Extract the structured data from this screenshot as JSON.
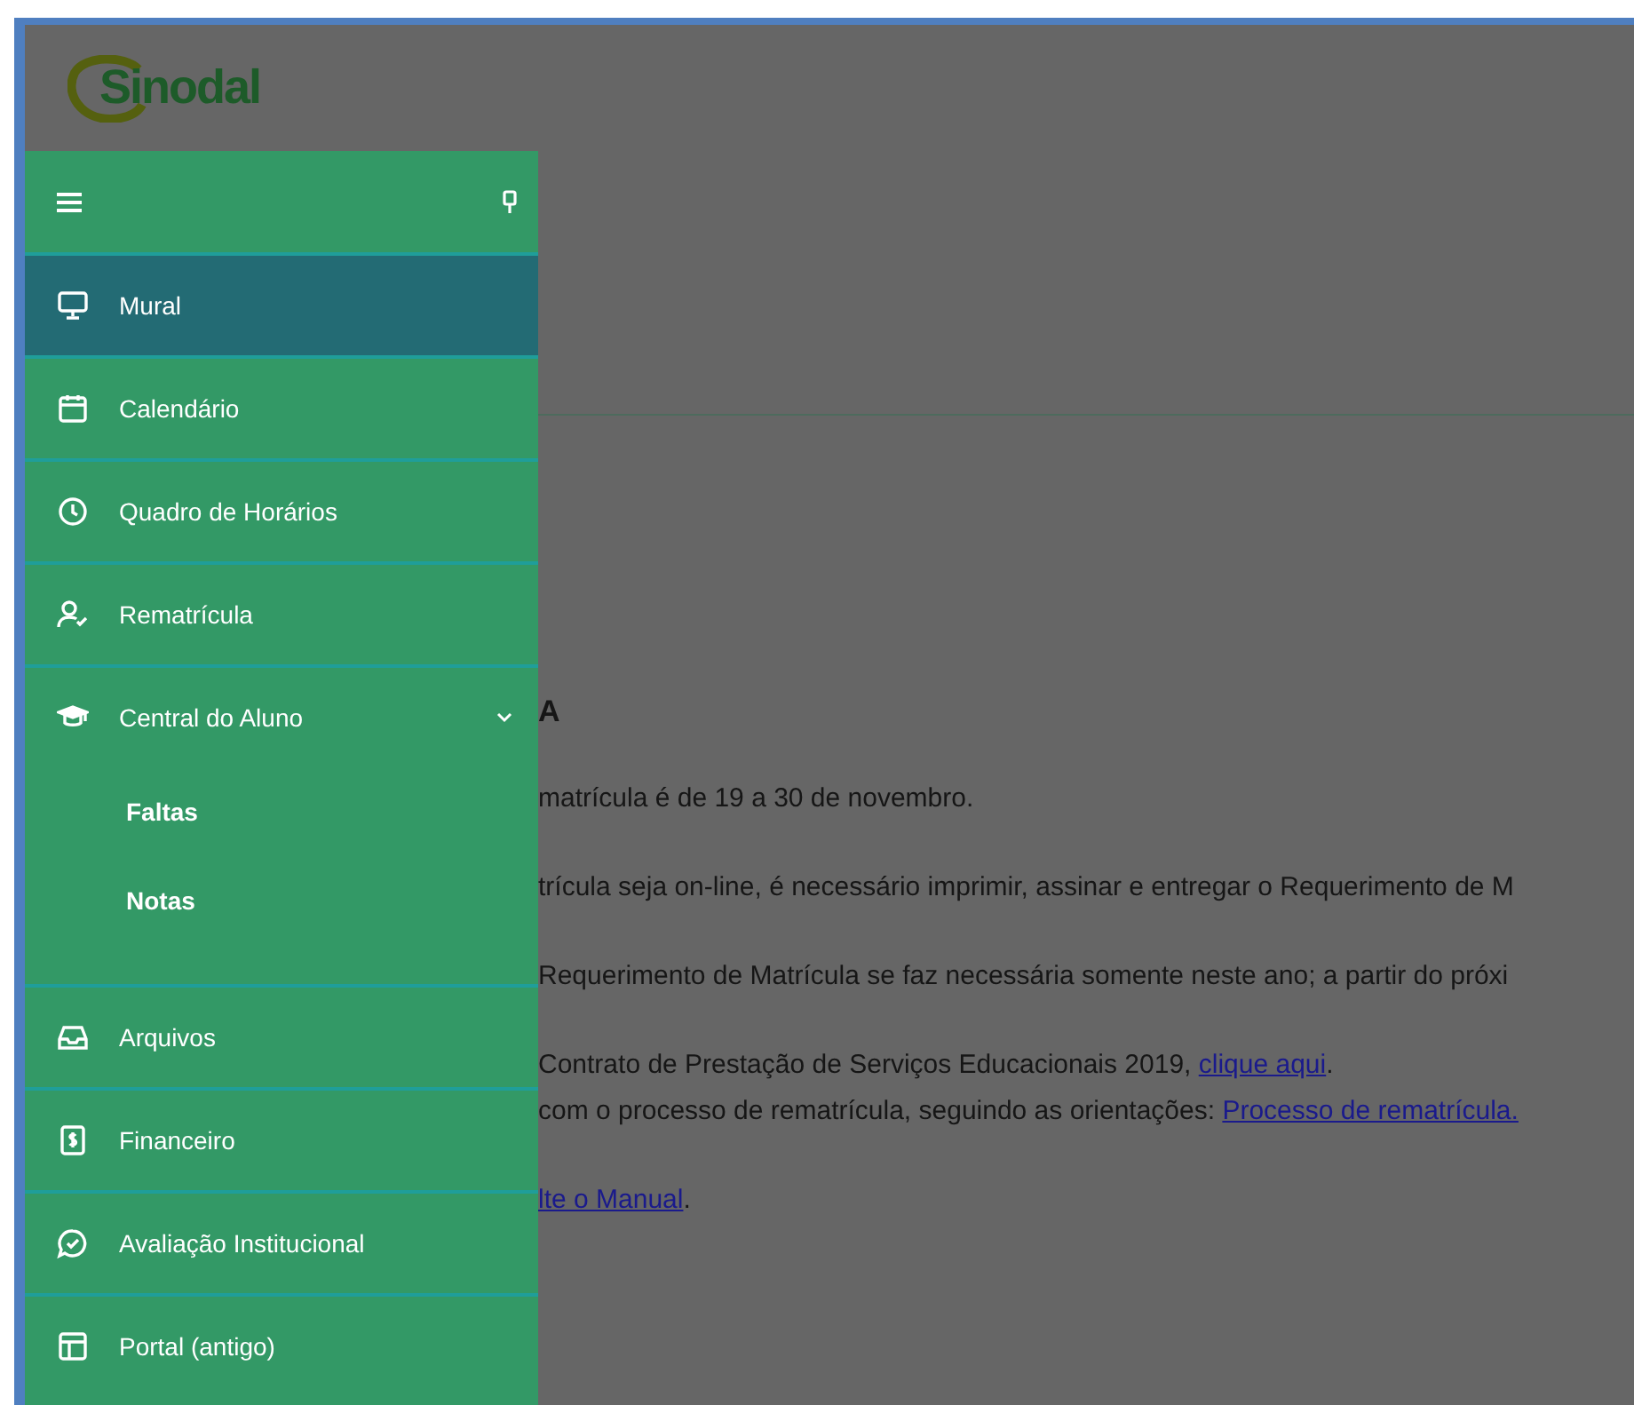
{
  "header": {
    "logo_text": "Sinodal"
  },
  "sidebar": {
    "items": [
      {
        "label": "Mural",
        "selected": true
      },
      {
        "label": "Calendário",
        "selected": false
      },
      {
        "label": "Quadro de Horários",
        "selected": false
      },
      {
        "label": "Rematrícula",
        "selected": false
      },
      {
        "label": "Central do Aluno",
        "selected": false,
        "expanded": true,
        "children": [
          {
            "label": "Faltas"
          },
          {
            "label": "Notas"
          }
        ]
      },
      {
        "label": "Arquivos",
        "selected": false
      },
      {
        "label": "Financeiro",
        "selected": false
      },
      {
        "label": "Avaliação Institucional",
        "selected": false
      },
      {
        "label": "Portal (antigo)",
        "selected": false
      }
    ]
  },
  "content": {
    "heading": "A",
    "paragraphs": [
      {
        "lines": [
          [
            {
              "kind": "text",
              "text": "matrícula é de 19 a 30 de novembro."
            }
          ]
        ]
      },
      {
        "lines": [
          [
            {
              "kind": "text",
              "text": "trícula seja on-line, é necessário imprimir, assinar e entregar o Requerimento de M"
            }
          ]
        ]
      },
      {
        "lines": [
          [
            {
              "kind": "text",
              "text": "Requerimento de Matrícula se faz necessária somente neste ano; a partir do próxi"
            }
          ]
        ]
      },
      {
        "lines": [
          [
            {
              "kind": "text",
              "text": "Contrato de Prestação de Serviços Educacionais 2019, "
            },
            {
              "kind": "link",
              "text": "clique aqui"
            },
            {
              "kind": "text",
              "text": "."
            }
          ],
          [
            {
              "kind": "text",
              "text": "com o processo de rematrícula, seguindo as orientações: "
            },
            {
              "kind": "link",
              "text": "Processo de rematrícula."
            }
          ]
        ]
      },
      {
        "lines": [
          [
            {
              "kind": "link",
              "text": "lte o Manual"
            },
            {
              "kind": "text",
              "text": "."
            }
          ]
        ]
      }
    ]
  }
}
